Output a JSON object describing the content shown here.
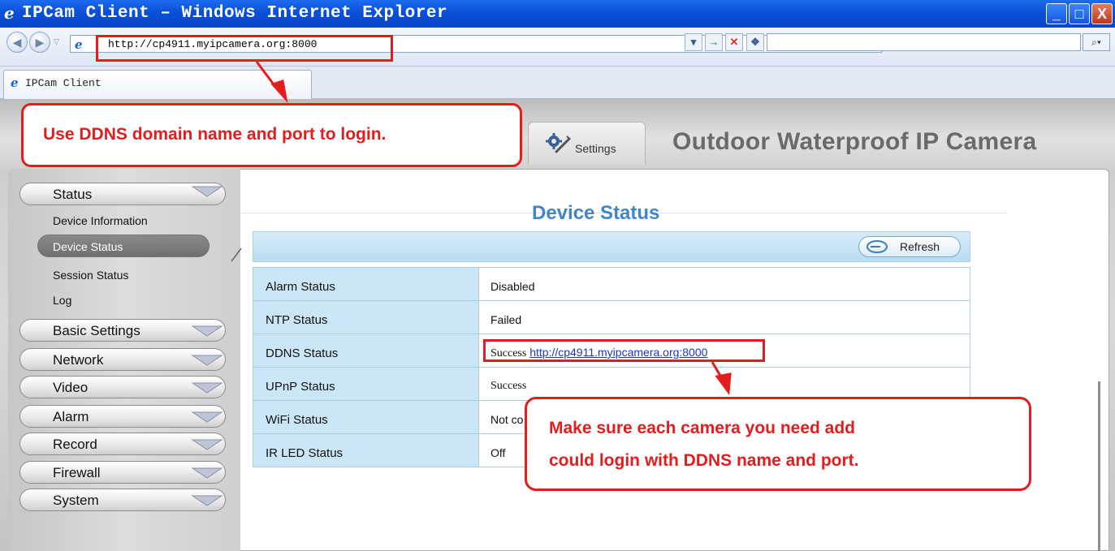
{
  "window": {
    "title": "IPCam Client – Windows Internet Explorer",
    "minimize_glyph": "_",
    "maximize_glyph": "□",
    "close_glyph": "X"
  },
  "addressbar": {
    "url": "http://cp4911.myipcamera.org:8000",
    "search_text": "",
    "back_glyph": "◀",
    "forward_glyph": "▶"
  },
  "tab": {
    "label": "IPCam Client"
  },
  "header": {
    "settings_label": "Settings",
    "brand_title": "Outdoor Waterproof IP Camera"
  },
  "sidebar": {
    "sections": [
      {
        "label": "Status",
        "expanded": true
      },
      {
        "label": "Basic Settings"
      },
      {
        "label": "Network"
      },
      {
        "label": "Video"
      },
      {
        "label": "Alarm"
      },
      {
        "label": "Record"
      },
      {
        "label": "Firewall"
      },
      {
        "label": "System"
      }
    ],
    "status_items": [
      {
        "label": "Device Information"
      },
      {
        "label": "Device Status",
        "active": true
      },
      {
        "label": "Session Status"
      },
      {
        "label": "Log"
      }
    ]
  },
  "main": {
    "heading": "Device Status",
    "refresh_label": "Refresh",
    "rows": [
      {
        "label": "Alarm Status",
        "value": "Disabled"
      },
      {
        "label": "NTP Status",
        "value": "Failed"
      },
      {
        "label": "DDNS Status",
        "value": "Success",
        "link": "http://cp4911.myipcamera.org:8000"
      },
      {
        "label": "UPnP Status",
        "value": "Success"
      },
      {
        "label": "WiFi Status",
        "value": "Not co"
      },
      {
        "label": "IR LED Status",
        "value": "Off"
      }
    ]
  },
  "annotations": {
    "top_callout": "Use DDNS domain name and port to login.",
    "bottom_callout_line1": "Make sure each camera you need add",
    "bottom_callout_line2": "could login with DDNS name and port.",
    "color": "#e31d1d"
  }
}
